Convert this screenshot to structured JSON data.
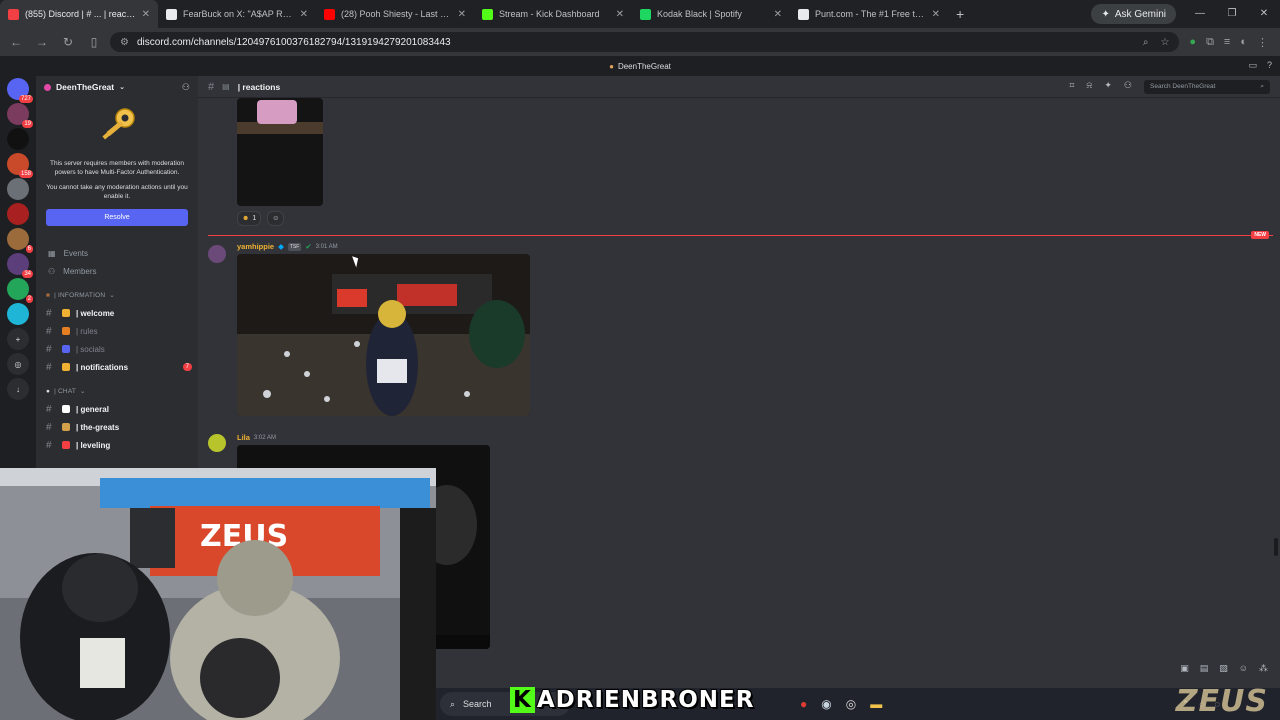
{
  "browser": {
    "tabs": [
      {
        "title": "(855) Discord | # ... | reactions",
        "color": "#f23f43",
        "active": true
      },
      {
        "title": "FearBuck on X: \"A$AP Rocky gi...",
        "color": "#e8eaed",
        "active": false
      },
      {
        "title": "(28) Pooh Shiesty - Last Sc...",
        "color": "#ff0000",
        "active": false
      },
      {
        "title": "Stream - Kick Dashboard",
        "color": "#53fc18",
        "active": false
      },
      {
        "title": "Kodak Black | Spotify",
        "color": "#1ed760",
        "active": false
      },
      {
        "title": "Punt.com - The #1 Free to Play...",
        "color": "#e8eaed",
        "active": false
      }
    ],
    "gemini_label": "Ask Gemini",
    "url": "discord.com/channels/1204976100376182794/1319194279201083443"
  },
  "topstrip": {
    "title": "DeenTheGreat"
  },
  "guilds": [
    {
      "label": "727",
      "color": "#5865f2"
    },
    {
      "label": "19",
      "color": "#7a3b5e"
    },
    {
      "label": "",
      "color": "#111111"
    },
    {
      "label": "158",
      "color": "#c94a2a"
    },
    {
      "label": "",
      "color": "#6b6f76"
    },
    {
      "label": "",
      "color": "#a82020"
    },
    {
      "label": "6",
      "color": "#9b6b3b"
    },
    {
      "label": "34",
      "color": "#5b3e7a"
    },
    {
      "label": "2",
      "color": "#23a55a"
    },
    {
      "label": "",
      "color": "#1fb5d6"
    }
  ],
  "sidebar": {
    "server_name": "DeenTheGreat",
    "mfa_text": "This server requires members with moderation powers to have Multi-Factor Authentication.",
    "mfa_subtext": "You cannot take any moderation actions until you enable it.",
    "resolve_label": "Resolve",
    "events_label": "Events",
    "members_label": "Members",
    "category_info": "| INFORMATION",
    "category_chat": "| CHAT",
    "channels_info": [
      {
        "name": "| welcome",
        "emoji_color": "#f0b232",
        "muted": false,
        "badge": ""
      },
      {
        "name": "| rules",
        "emoji_color": "#e67e22",
        "muted": true,
        "badge": ""
      },
      {
        "name": "| socials",
        "emoji_color": "#5865f2",
        "muted": true,
        "badge": ""
      },
      {
        "name": "| notifications",
        "emoji_color": "#f0b232",
        "muted": false,
        "badge": "7"
      }
    ],
    "channels_chat": [
      {
        "name": "| general",
        "emoji_color": "#ffffff",
        "muted": false,
        "badge": ""
      },
      {
        "name": "| the-greats",
        "emoji_color": "#d4a04a",
        "muted": false,
        "badge": ""
      },
      {
        "name": "| leveling",
        "emoji_color": "#f23f43",
        "muted": false,
        "badge": ""
      }
    ]
  },
  "channel": {
    "name": "| reactions",
    "search_placeholder": "Search DeenTheGreat"
  },
  "messages": {
    "reaction_count": "1",
    "new_label": "NEW",
    "msg1": {
      "username": "yamhippie",
      "tag": "TSF",
      "time": "3:01 AM",
      "name_color": "#f0b232"
    },
    "msg2": {
      "username": "Lila",
      "time": "3:02 AM",
      "name_color": "#f0b232"
    }
  },
  "taskbar": {
    "search_label": "Search"
  },
  "overlay": {
    "streamer_name": "ADRIENBRONER",
    "kick_letter": "K",
    "brand": "ZEUS"
  },
  "webcam_scene": {
    "banner_text": "ZEUS"
  }
}
